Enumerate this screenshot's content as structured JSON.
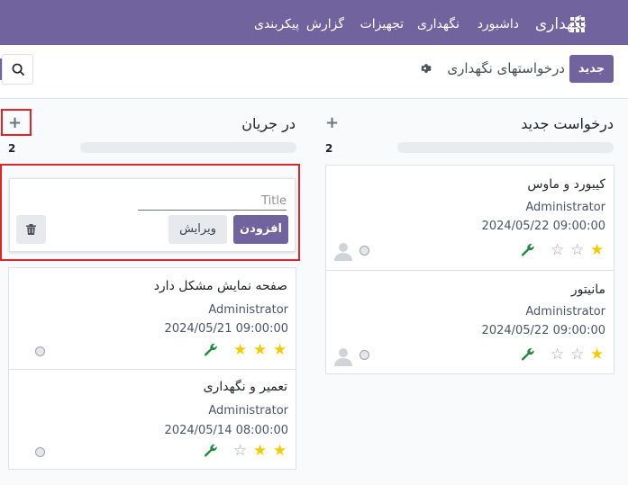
{
  "navbar": {
    "brand": "نگهداری",
    "menu": [
      "داشبورد",
      "نگهداری",
      "تجهیزات",
      "گزارش",
      "پیکربندی"
    ],
    "bg_color": "#71639e"
  },
  "control_panel": {
    "new_button": "جدید",
    "breadcrumb": "درخواستهای نگهداری",
    "settings_icon": "gear-icon",
    "search_icon": "search-icon"
  },
  "columns": [
    {
      "title": "درخواست جدید",
      "count": "2",
      "cards": [
        {
          "title": "کیبورد و ماوس",
          "user": "Administrator",
          "date": "2024/05/22 09:00:00",
          "stars": 1,
          "has_avatar": true
        },
        {
          "title": "مانیتور",
          "user": "Administrator",
          "date": "2024/05/22 09:00:00",
          "stars": 1,
          "has_avatar": true
        }
      ]
    },
    {
      "title": "در جریان",
      "count": "2",
      "quick_create": {
        "placeholder": "Title",
        "add_label": "افزودن",
        "edit_label": "ویرایش"
      },
      "cards": [
        {
          "title": "صفحه نمایش مشکل دارد",
          "user": "Administrator",
          "date": "2024/05/21 09:00:00",
          "stars": 3,
          "has_avatar": false
        },
        {
          "title": "تعمیر و نگهداری",
          "user": "Administrator",
          "date": "2024/05/14 08:00:00",
          "stars": 2,
          "has_avatar": false
        }
      ]
    }
  ],
  "colors": {
    "accent": "#71639e",
    "star": "#f3cc00",
    "wrench": "#1f8a3b",
    "highlight": "#e0242a"
  }
}
